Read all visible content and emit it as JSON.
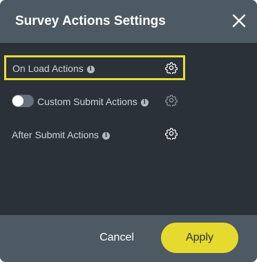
{
  "dialog": {
    "title": "Survey Actions Settings",
    "close_icon": "close-icon"
  },
  "rows": [
    {
      "label": "On Load Actions",
      "info_glyph": "i",
      "icon": "gear-icon",
      "highlighted": true,
      "has_toggle": false
    },
    {
      "label": "Custom Submit Actions",
      "info_glyph": "i",
      "icon": "gear-icon",
      "highlighted": false,
      "has_toggle": true,
      "toggle_on": false,
      "disabled": true
    },
    {
      "label": "After Submit Actions",
      "info_glyph": "i",
      "icon": "gear-icon",
      "highlighted": false,
      "has_toggle": false
    }
  ],
  "footer": {
    "cancel_label": "Cancel",
    "apply_label": "Apply"
  },
  "colors": {
    "header_bg": "#4d5963",
    "body_bg": "#2a3138",
    "accent": "#e6da2f",
    "highlight_border": "#e7dd34",
    "text": "#cfd5da"
  }
}
